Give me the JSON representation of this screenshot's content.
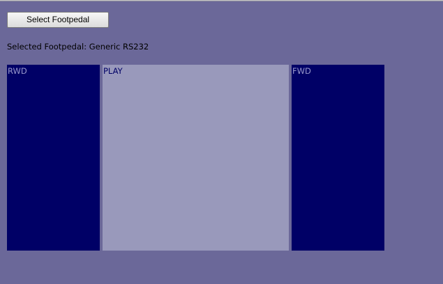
{
  "toolbar": {
    "select_button_label": "Select Footpedal"
  },
  "status": {
    "selected_footpedal_text": "Selected Footpedal: Generic RS232"
  },
  "pedals": [
    {
      "label": "RWD",
      "state": "inactive"
    },
    {
      "label": "PLAY",
      "state": "active"
    },
    {
      "label": "FWD",
      "state": "inactive"
    }
  ],
  "colors": {
    "background": "#6b6899",
    "pedal_inactive": "#000066",
    "pedal_active": "#9999bb",
    "pedal_inactive_text": "#9999cc",
    "pedal_active_text": "#000066"
  }
}
